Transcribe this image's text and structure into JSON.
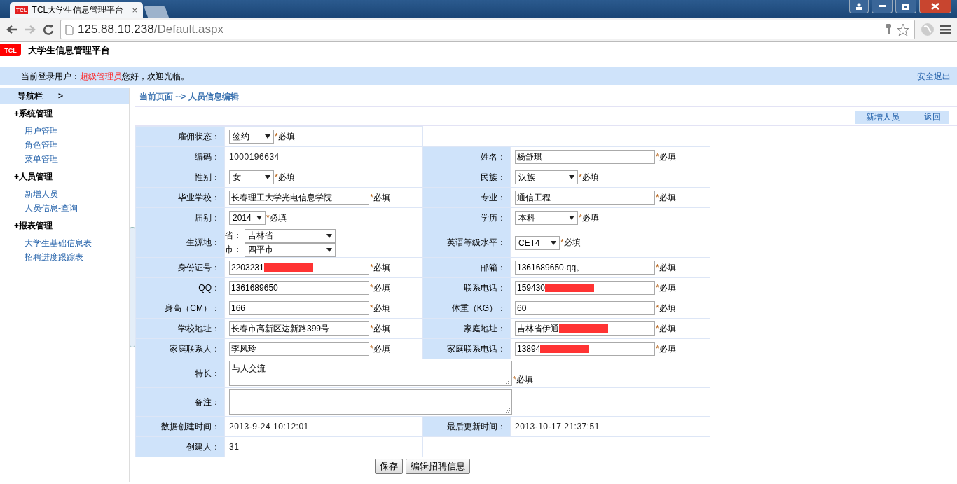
{
  "browser": {
    "favicon_text": "TCL",
    "tab_title": "TCL大学生信息管理平台",
    "close_tab": "×",
    "url_host": "125.88.10.238",
    "url_path": "/Default.aspx",
    "forward_disabled": true
  },
  "header": {
    "logo": "TCL",
    "title": "大学生信息管理平台"
  },
  "userbar": {
    "prefix": "当前登录用户：",
    "user": "超级管理员",
    "greeting": "您好，欢迎光临。",
    "logout": "安全退出"
  },
  "sidebar": {
    "title": "导航栏",
    "toggle": ">",
    "groups": [
      {
        "marker": "+",
        "label": "系统管理",
        "items": [
          "用户管理",
          "角色管理",
          "菜单管理"
        ]
      },
      {
        "marker": "+",
        "label": "人员管理",
        "items": [
          "新增人员",
          "人员信息-查询"
        ]
      },
      {
        "marker": "+",
        "label": "报表管理",
        "items": [
          "大学生基础信息表",
          "招聘进度跟踪表"
        ]
      }
    ]
  },
  "breadcrumb": "当前页面 --> 人员信息编辑",
  "actions": [
    "新增人员",
    "返回"
  ],
  "form": {
    "rows": [
      {
        "cells": [
          {
            "label": "雇佣状态：",
            "field": {
              "kind": "select",
              "value": "签约",
              "mark": "*",
              "note": "必填"
            }
          }
        ]
      },
      {
        "cells": [
          {
            "label": "编码：",
            "field": {
              "kind": "text",
              "value": "1000196634"
            }
          },
          {
            "label": "姓名：",
            "field": {
              "kind": "input",
              "value": "杨舒琪",
              "mark": "*",
              "note": "必填"
            }
          }
        ]
      },
      {
        "cells": [
          {
            "label": "性别：",
            "field": {
              "kind": "select",
              "value": "女",
              "mark": "*",
              "note": "必填"
            }
          },
          {
            "label": "民族：",
            "field": {
              "kind": "select",
              "value": "汉族",
              "mark": "*",
              "note": "必填"
            }
          }
        ]
      },
      {
        "cells": [
          {
            "label": "毕业学校：",
            "field": {
              "kind": "input",
              "value": "长春理工大学光电信息学院",
              "mark": "*",
              "note": "必填"
            }
          },
          {
            "label": "专业：",
            "field": {
              "kind": "input",
              "value": "通信工程",
              "mark": "*",
              "note": "必填"
            }
          }
        ]
      },
      {
        "cells": [
          {
            "label": "届别：",
            "field": {
              "kind": "select",
              "value": "2014",
              "mark": "*",
              "note": "必填"
            }
          },
          {
            "label": "学历：",
            "field": {
              "kind": "select",
              "value": "本科",
              "mark": "*",
              "note": "必填"
            }
          }
        ]
      },
      {
        "cells": [
          {
            "label": "生源地：",
            "field": {
              "kind": "region",
              "parts": [
                {
                  "label": "省：",
                  "value": "吉林省"
                },
                {
                  "label": "市：",
                  "value": "四平市"
                }
              ]
            }
          },
          {
            "label": "英语等级水平：",
            "field": {
              "kind": "select",
              "value": "CET4",
              "mark": "*",
              "note": "必填"
            }
          }
        ]
      },
      {
        "cells": [
          {
            "label": "身份证号：",
            "field": {
              "kind": "input",
              "value": "2203231",
              "redacted": true,
              "mark": "*",
              "note": "必填"
            }
          },
          {
            "label": "邮箱：",
            "field": {
              "kind": "input",
              "value": "1361689650·qq。",
              "mark": "*",
              "note": "必填"
            }
          }
        ]
      },
      {
        "cells": [
          {
            "label": "QQ：",
            "field": {
              "kind": "input",
              "value": "1361689650",
              "mark": "*",
              "note": "必填"
            }
          },
          {
            "label": "联系电话：",
            "field": {
              "kind": "input",
              "value": "159430",
              "redacted": true,
              "mark": "*",
              "note": "必填"
            }
          }
        ]
      },
      {
        "cells": [
          {
            "label": "身高（CM）：",
            "field": {
              "kind": "input",
              "value": "166",
              "mark": "*",
              "note": "必填"
            }
          },
          {
            "label": "体重（KG）：",
            "field": {
              "kind": "input",
              "value": "60",
              "mark": "*",
              "note": "必填"
            }
          }
        ]
      },
      {
        "cells": [
          {
            "label": "学校地址：",
            "field": {
              "kind": "input",
              "value": "长春市高新区达新路399号",
              "mark": "*",
              "note": "必填"
            }
          },
          {
            "label": "家庭地址：",
            "field": {
              "kind": "input",
              "value": "吉林省伊通",
              "redacted": true,
              "mark": "*",
              "note": "必填"
            }
          }
        ]
      },
      {
        "cells": [
          {
            "label": "家庭联系人：",
            "field": {
              "kind": "input",
              "value": "李凤玲",
              "mark": "*",
              "note": "必填"
            }
          },
          {
            "label": "家庭联系电话：",
            "field": {
              "kind": "input",
              "value": "13894",
              "redacted": true,
              "mark": "*",
              "note": "必填"
            }
          }
        ]
      },
      {
        "cells": [
          {
            "label": "特长：",
            "field": {
              "kind": "textarea",
              "value": "与人交流",
              "mark": "*",
              "note": "必填"
            }
          }
        ]
      },
      {
        "cells": [
          {
            "label": "备注：",
            "field": {
              "kind": "textarea"
            }
          }
        ]
      },
      {
        "cells": [
          {
            "label": "数据创建时间：",
            "field": {
              "kind": "text",
              "value": "2013-9-24 10:12:01"
            }
          },
          {
            "label": "最后更新时间：",
            "field": {
              "kind": "text",
              "value": "2013-10-17 21:37:51"
            }
          }
        ]
      },
      {
        "cells": [
          {
            "label": "创建人：",
            "field": {
              "kind": "text",
              "value": "31"
            }
          }
        ]
      }
    ]
  },
  "buttons": [
    "保存",
    "编辑招聘信息"
  ]
}
